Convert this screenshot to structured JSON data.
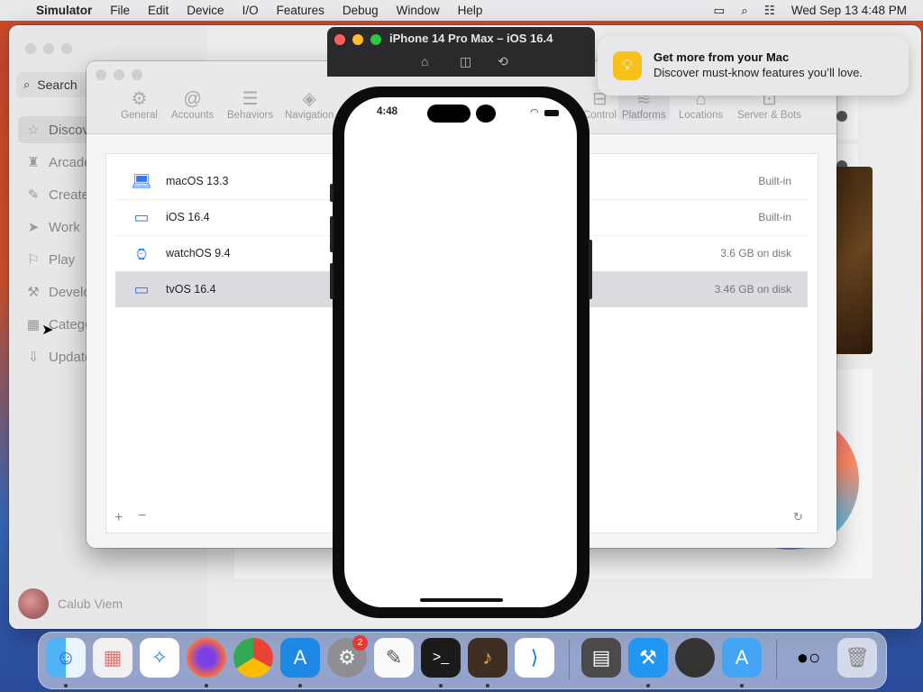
{
  "menubar": {
    "apple_icon": "apple-logo",
    "app_name": "Simulator",
    "menus": [
      "File",
      "Edit",
      "Device",
      "I/O",
      "Features",
      "Debug",
      "Window",
      "Help"
    ],
    "datetime": "Wed Sep 13  4:48 PM"
  },
  "appstore": {
    "search_label": "Search",
    "sidebar": [
      {
        "label": "Discover",
        "icon": "star-icon"
      },
      {
        "label": "Arcade",
        "icon": "joystick-icon"
      },
      {
        "label": "Create",
        "icon": "brush-icon"
      },
      {
        "label": "Work",
        "icon": "send-icon"
      },
      {
        "label": "Play",
        "icon": "rocket-icon"
      },
      {
        "label": "Develop",
        "icon": "hammer-icon"
      },
      {
        "label": "Categories",
        "icon": "grid-icon"
      },
      {
        "label": "Updates",
        "icon": "download-icon"
      }
    ],
    "user_name": "Calub Viem"
  },
  "settings": {
    "title": "Platforms",
    "tabs": [
      {
        "label": "General",
        "icon": "gear-icon"
      },
      {
        "label": "Accounts",
        "icon": "at-icon"
      },
      {
        "label": "Behaviors",
        "icon": "behaviors-icon"
      },
      {
        "label": "Navigation",
        "icon": "navigation-icon"
      },
      {
        "label": "Control",
        "icon": "source-control-icon"
      },
      {
        "label": "Platforms",
        "icon": "layers-icon"
      },
      {
        "label": "Locations",
        "icon": "drive-icon"
      },
      {
        "label": "Server & Bots",
        "icon": "bot-icon"
      }
    ],
    "selected_tab": "Platforms",
    "platforms": [
      {
        "name": "macOS 13.3",
        "status": "Built-in",
        "icon": "laptop-icon"
      },
      {
        "name": "iOS 16.4",
        "status": "Built-in",
        "icon": "iphone-ipad-icon"
      },
      {
        "name": "watchOS 9.4",
        "status": "3.6 GB on disk",
        "icon": "watch-icon"
      },
      {
        "name": "tvOS 16.4",
        "status": "3.46 GB on disk",
        "icon": "tv-icon"
      }
    ],
    "selected_platform": "tvOS 16.4",
    "add_label": "+",
    "remove_label": "−",
    "refresh_icon": "refresh-icon"
  },
  "simulator": {
    "title": "iPhone 14 Pro Max – iOS 16.4",
    "toolbar": [
      "home-icon",
      "screenshot-icon",
      "rotate-icon"
    ],
    "status_time": "4:48"
  },
  "notification": {
    "title": "Get more from your Mac",
    "body": "Discover must-know features you’ll love.",
    "icon": "lightbulb-icon"
  },
  "dock": {
    "apps": [
      "Finder",
      "Launchpad",
      "Safari",
      "Firefox",
      "Chrome",
      "App Store",
      "System Settings",
      "TextEdit",
      "Terminal",
      "GarageBand",
      "Visual Studio Code",
      "Calculator",
      "Xcode",
      "Profile",
      "Simulator",
      "Mirror",
      "Trash"
    ],
    "badge": "2"
  }
}
